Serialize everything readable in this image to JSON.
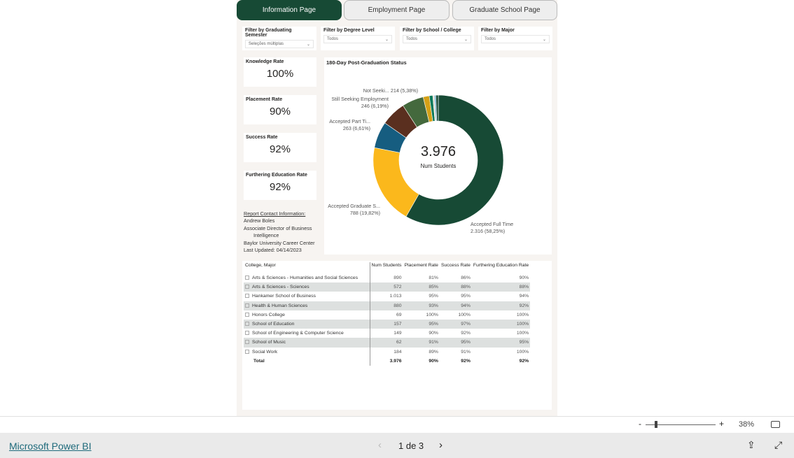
{
  "tabs": [
    {
      "label": "Information Page",
      "active": true
    },
    {
      "label": "Employment Page"
    },
    {
      "label": "Graduate School Page"
    }
  ],
  "filters": [
    {
      "label": "Filter by Graduating Semester",
      "value": "Seleções múltiplas"
    },
    {
      "label": "Filter by Degree Level",
      "value": "Todos"
    },
    {
      "label": "Filter by School / College",
      "value": "Todos"
    },
    {
      "label": "Filter by Major",
      "value": "Todos"
    }
  ],
  "cards": [
    {
      "title": "Knowledge Rate",
      "value": "100%"
    },
    {
      "title": "Placement Rate",
      "value": "90%"
    },
    {
      "title": "Success Rate",
      "value": "92%"
    },
    {
      "title": "Furthering Education Rate",
      "value": "92%"
    }
  ],
  "contact": {
    "heading": "Report Contact Information:",
    "name": "Andrew Boles",
    "title1": "Associate Director of Business",
    "title2": "Intelligence",
    "org": "Baylor University Career Center",
    "updated": "Last Updated: 04/14/2023"
  },
  "chart_data": {
    "type": "pie",
    "title": "180-Day Post-Graduation Status",
    "center_value": "3.976",
    "center_label": "Num Students",
    "slices": [
      {
        "name": "Accepted Full Time",
        "value": 2316,
        "label": "2.316 (58,25%)",
        "color": "#174a35"
      },
      {
        "name": "Accepted Graduate S...",
        "value": 788,
        "label": "788 (19,82%)",
        "color": "#fbb81c"
      },
      {
        "name": "Accepted Part Ti...",
        "value": 263,
        "label": "263 (6,61%)",
        "color": "#165d80"
      },
      {
        "name": "Still Seeking Employment",
        "value": 246,
        "label": "246 (6,19%)",
        "color": "#5a2f1f"
      },
      {
        "name": "Not Seeki...",
        "value": 214,
        "label": "214 (5,38%)",
        "color": "#44693d"
      },
      {
        "value": 60,
        "color": "#d4a017"
      },
      {
        "value": 35,
        "color": "#0b7a5a"
      },
      {
        "value": 16,
        "color": "#e3d8c8"
      },
      {
        "value": 14,
        "color": "#5ba4c9"
      },
      {
        "value": 24,
        "color": "#174a35"
      }
    ]
  },
  "table": {
    "headers": [
      "College, Major",
      "Num Students",
      "Placement Rate",
      "Success Rate",
      "Furthering Education Rate"
    ],
    "rows": [
      [
        "Arts & Sciences - Humanities and Social Sciences",
        "890",
        "81%",
        "86%",
        "90%"
      ],
      [
        "Arts & Sciences - Sciences",
        "572",
        "85%",
        "88%",
        "88%"
      ],
      [
        "Hankamer School of Business",
        "1.013",
        "95%",
        "95%",
        "94%"
      ],
      [
        "Health & Human Sciences",
        "880",
        "93%",
        "94%",
        "92%"
      ],
      [
        "Honors College",
        "69",
        "100%",
        "100%",
        "100%"
      ],
      [
        "School of Education",
        "157",
        "95%",
        "97%",
        "100%"
      ],
      [
        "School of Engineering & Computer Science",
        "149",
        "90%",
        "92%",
        "100%"
      ],
      [
        "School of Music",
        "62",
        "91%",
        "95%",
        "95%"
      ],
      [
        "Social Work",
        "184",
        "89%",
        "91%",
        "100%"
      ]
    ],
    "total": [
      "Total",
      "3.976",
      "90%",
      "92%",
      "92%"
    ]
  },
  "zoom": {
    "minus": "-",
    "plus": "+",
    "level": "38%"
  },
  "footer": {
    "brand": "Microsoft Power BI",
    "page": "1 de 3"
  }
}
